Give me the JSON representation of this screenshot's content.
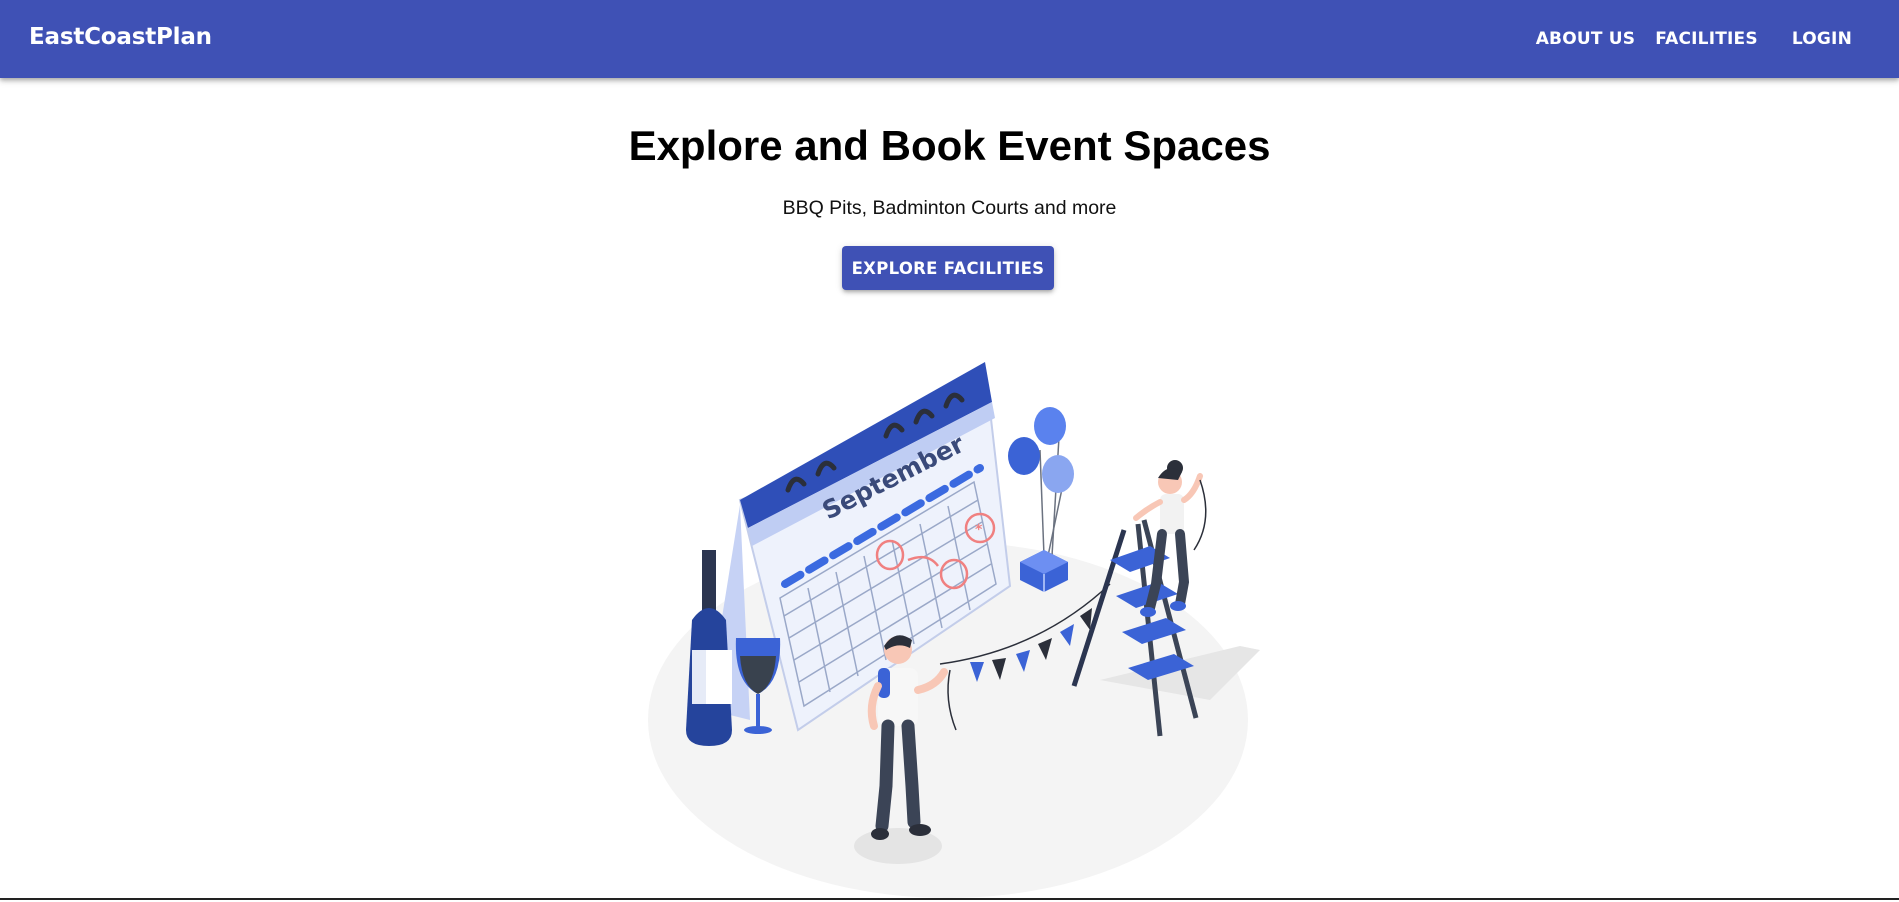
{
  "header": {
    "brand": "EastCoastPlan",
    "nav": {
      "about_label": "ABOUT US",
      "facilities_label": "FACILITIES",
      "login_label": "LOGIN"
    }
  },
  "hero": {
    "title": "Explore and Book Event Spaces",
    "subtitle": "BBQ Pits, Badminton Courts and more",
    "cta_label": "EXPLORE FACILITIES"
  },
  "illustration": {
    "calendar_month": "September"
  },
  "colors": {
    "primary": "#3f51b5",
    "illustration_blue": "#2c4fbf",
    "illustration_light_blue": "#bfcdf3",
    "annotation_red": "#f08080"
  }
}
